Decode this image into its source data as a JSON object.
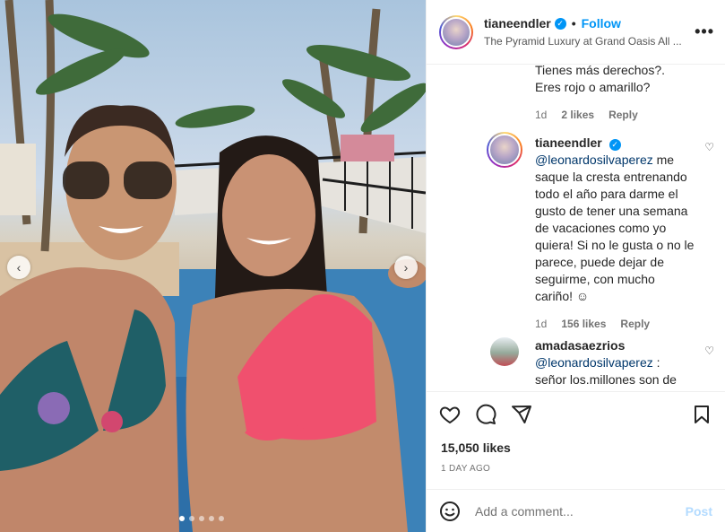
{
  "post": {
    "username": "tianeendler",
    "verified": true,
    "separator": "•",
    "follow_label": "Follow",
    "location": "The Pyramid Luxury at Grand Oasis All ...",
    "more_icon": "more-horizontal-icon",
    "more_label": "•••"
  },
  "photo": {
    "prev_label": "‹",
    "next_label": "›",
    "slides": 5,
    "active_slide": 1
  },
  "comments": {
    "partial": {
      "text": "Tienes más derechos?. Eres rojo o amarillo?",
      "age": "1d",
      "likes": "2 likes",
      "reply": "Reply"
    },
    "reply1": {
      "username": "tianeendler",
      "mention": "@leonardosilvaperez",
      "text": " me saque la cresta entrenando todo el año para darme el gusto de tener una semana de vacaciones como yo quiera! Si no le gusta o no le parece, puede dejar de seguirme, con mucho cariño! ☺",
      "age": "1d",
      "likes": "156 likes",
      "reply": "Reply",
      "heart": "♡"
    },
    "reply2": {
      "username": "amadasaezrios",
      "mention": "@leonardosilvaperez",
      "text": " : señor los.millones son de",
      "heart": "♡"
    }
  },
  "actions": {
    "likes": "15,050 likes",
    "date": "1 DAY AGO"
  },
  "composer": {
    "emoji_icon": "emoji-icon",
    "placeholder": "Add a comment...",
    "post_label": "Post"
  },
  "colors": {
    "accent": "#0095f6",
    "post_disabled": "#b3dbff",
    "mention": "#00376b"
  }
}
